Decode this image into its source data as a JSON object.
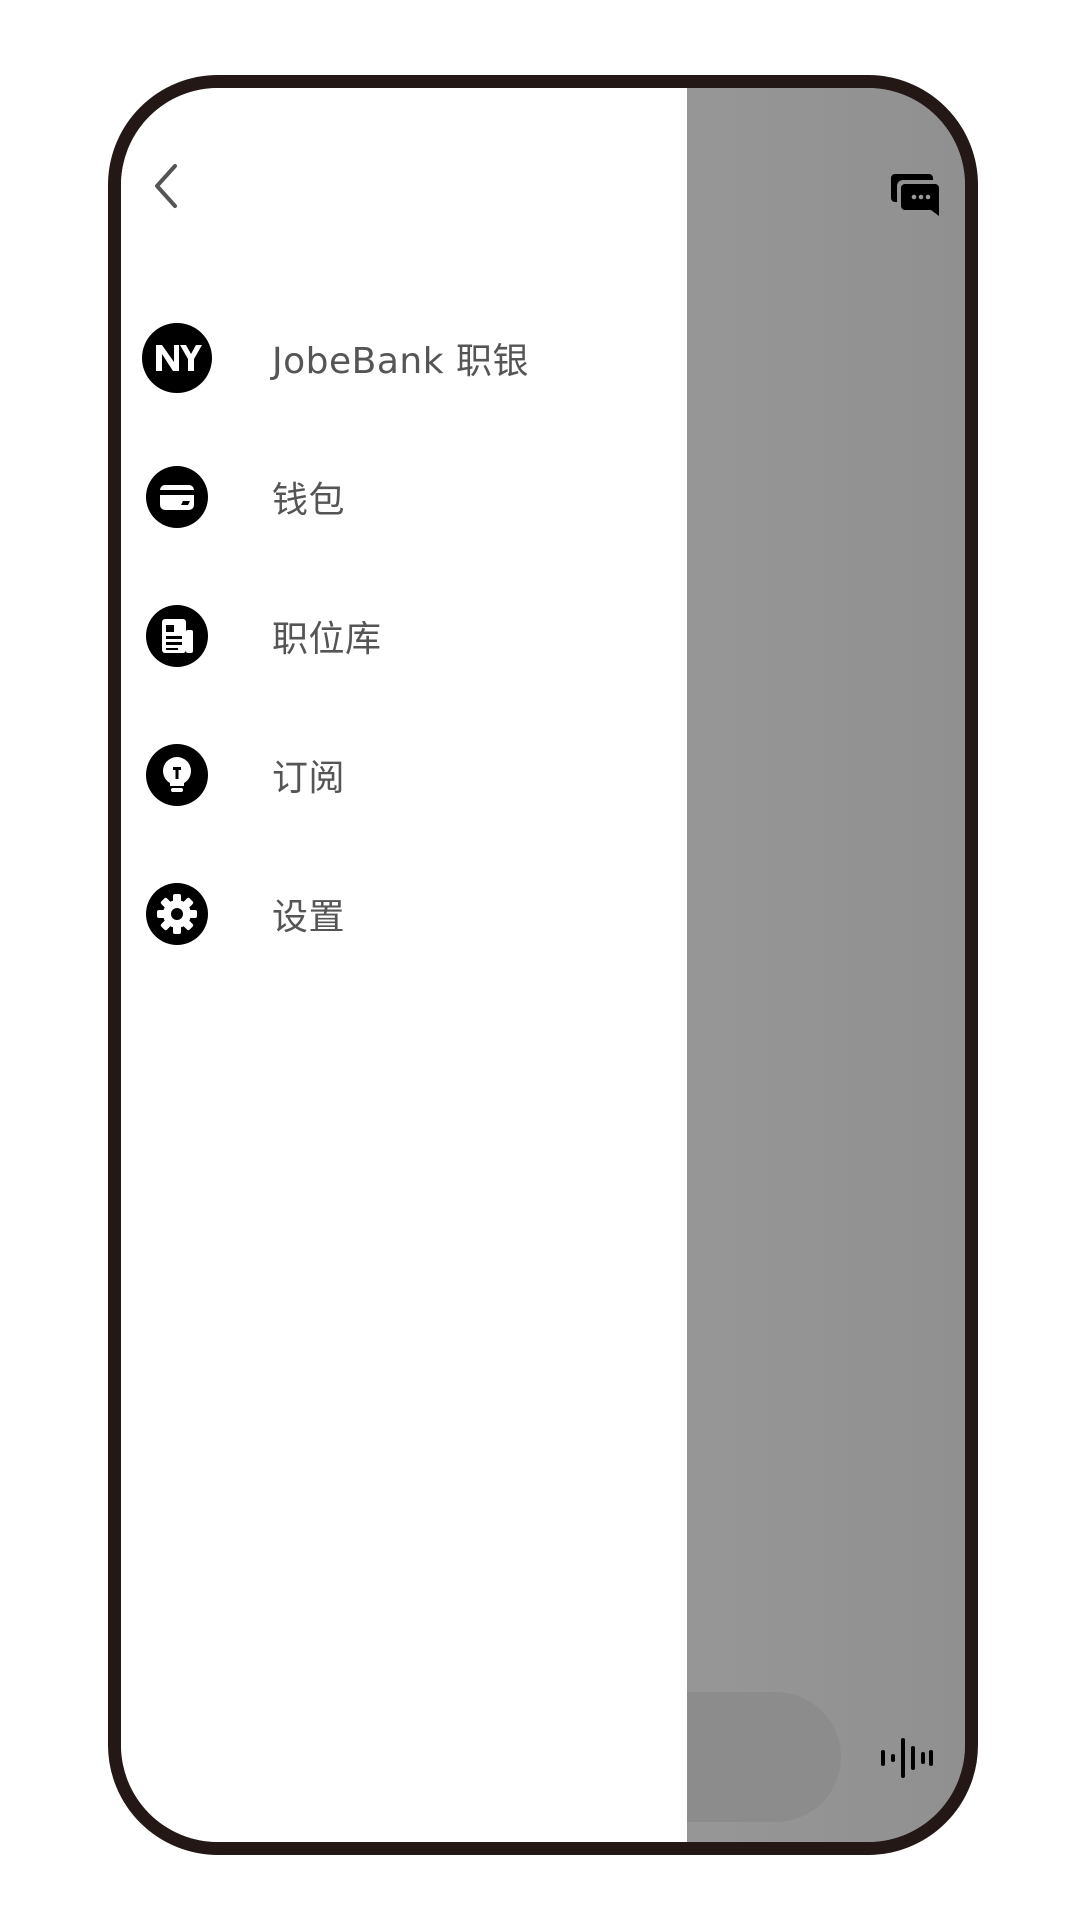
{
  "drawer": {
    "back_icon": "chevron-left-icon",
    "items": [
      {
        "label": "JobeBank 职银",
        "icon": "ny-logo-icon"
      },
      {
        "label": "钱包",
        "icon": "wallet-icon"
      },
      {
        "label": "职位库",
        "icon": "document-icon"
      },
      {
        "label": "订阅",
        "icon": "lightbulb-icon"
      },
      {
        "label": "设置",
        "icon": "gear-icon"
      }
    ]
  },
  "background": {
    "chat_icon": "chat-bubbles-icon",
    "voice_icon": "voice-waveform-icon"
  },
  "colors": {
    "frame": "#231815",
    "scrim": "#989898",
    "label": "#555555",
    "icon": "#000000"
  }
}
